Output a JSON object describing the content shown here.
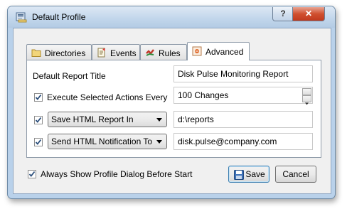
{
  "window": {
    "title": "Default Profile",
    "help_symbol": "?",
    "close_symbol": "✕",
    "icon": "profile-icon"
  },
  "tabs": [
    {
      "label": "Directories",
      "icon": "folder-icon"
    },
    {
      "label": "Events",
      "icon": "events-icon"
    },
    {
      "label": "Rules",
      "icon": "rules-icon"
    },
    {
      "label": "Advanced",
      "icon": "advanced-icon",
      "active": true
    }
  ],
  "advanced": {
    "report_title_label": "Default Report Title",
    "report_title_value": "Disk Pulse Monitoring Report",
    "execute_label": "Execute Selected Actions Every",
    "execute_checked": true,
    "execute_value": "100 Changes",
    "save_report_checked": true,
    "save_report_option": "Save HTML Report In",
    "save_report_path": "d:\\reports",
    "notify_checked": true,
    "notify_option": "Send HTML Notification To",
    "notify_email": "disk.pulse@company.com"
  },
  "footer": {
    "always_show_label": "Always Show Profile Dialog Before Start",
    "always_show_checked": true,
    "save_label": "Save",
    "cancel_label": "Cancel"
  }
}
